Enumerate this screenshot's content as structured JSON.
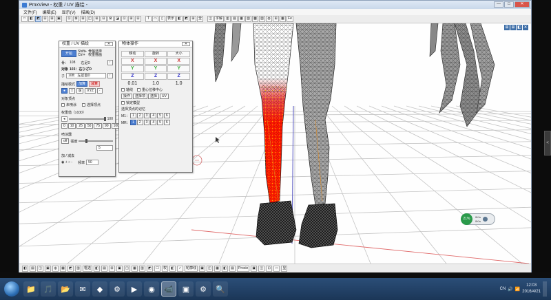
{
  "window": {
    "title": "PmxView - 权重 / UV 描绘 -",
    "min": "—",
    "max": "□",
    "close": "✕"
  },
  "menu": [
    "文件(F)",
    "编辑(E)",
    "显示(V)",
    "描画(D)"
  ],
  "toolbar": [
    "□",
    "◧",
    "◩",
    "⊟",
    "⊞",
    "▣",
    "⊡",
    "⊠",
    "⊞",
    "◫",
    "⊞",
    "⊟",
    "⊠",
    "◪",
    "⊡",
    "⊞",
    "⊟",
    "T",
    "▭",
    "▯",
    "表示",
    "◧",
    "◩",
    "⊞",
    "全",
    "◫",
    "字解",
    "▥",
    "▤",
    "▦",
    "▧",
    "▩",
    "▨",
    "◍",
    "⊞",
    "▦",
    "Fe"
  ],
  "viewport_icons": [
    "⊞",
    "⊞",
    "◧",
    "✕"
  ],
  "weight_panel": {
    "title": "权重 / UV 描绘",
    "close": "✕",
    "start_button": "开始",
    "shift_hint": "Shift+\nCtrl+",
    "display_hint": "骨骼选择\n权重描画",
    "bone_label": "骨：",
    "bone_value": "108",
    "bone_name": "右足D",
    "target_label": "对象",
    "target_value": "103：右ひざD",
    "sub_label": "子",
    "sub_value": "108：左足首D",
    "mode_label": "描绘模式",
    "mode_btn1": "加算",
    "mode_btn2": "减算",
    "tools": [
      "●",
      "□",
      "⊠",
      "XYZ",
      "·"
    ],
    "target_vertex_label": "对象顶点",
    "opt_unpainted": "未喷涂",
    "opt_selected": "选择顶点",
    "weight_label": "权重值（x100）",
    "weight_value": "100",
    "presets": [
      "0",
      "10",
      "25",
      "50",
      "75",
      "90",
      "100"
    ],
    "brush_label": "喷涂器",
    "brush_strength_label": "强度",
    "brush_strength": "5",
    "addsub_label": "加 / 减去",
    "freq_label": "频率",
    "freq_value": "50"
  },
  "object_panel": {
    "title": "物体操作",
    "close": "✕",
    "headers": [
      "移动",
      "旋转",
      "大小"
    ],
    "scale": [
      "0.01",
      "1.0",
      "1.0"
    ],
    "opt_axis": "轴线",
    "opt_center": "重心位移中心",
    "tabs": [
      "操作",
      "选择项",
      "选择",
      "UV"
    ],
    "lock_model": "锁定模型",
    "selection_label": "选择顶点的记忆",
    "m1_label": "M1：",
    "mr_label": "MR：",
    "m1_slots": [
      "1",
      "2",
      "3",
      "4",
      "5",
      "6"
    ],
    "mr_slots": [
      "1",
      "2",
      "3",
      "4",
      "5",
      "6"
    ]
  },
  "statusbar": [
    "◧",
    "▤",
    "◫",
    "▣",
    "◍",
    "▦",
    "◩",
    "▥",
    "框选",
    "◧",
    "▤",
    "⊞",
    "▣",
    "◫",
    "▦",
    "▥",
    "◩",
    "☐",
    "权",
    "◧",
    "✓",
    "轮廓线",
    "▣",
    "◫",
    "▦",
    "◧",
    "▤",
    "Proxie",
    "▣",
    "◫",
    "⊡",
    "□",
    "显"
  ],
  "overlay": {
    "percent": "21%",
    "meter_top": "0K/s",
    "meter_bottom": "0K/s"
  },
  "taskbar": {
    "apps": [
      "📁",
      "🎵",
      "📂",
      "✉",
      "◆",
      "⚙",
      "▶",
      "◉",
      "📹",
      "▣",
      "⚙",
      "🔍"
    ],
    "time": "12:03",
    "date": "2016/4/21",
    "lang": "CN"
  },
  "side_grab": "<"
}
